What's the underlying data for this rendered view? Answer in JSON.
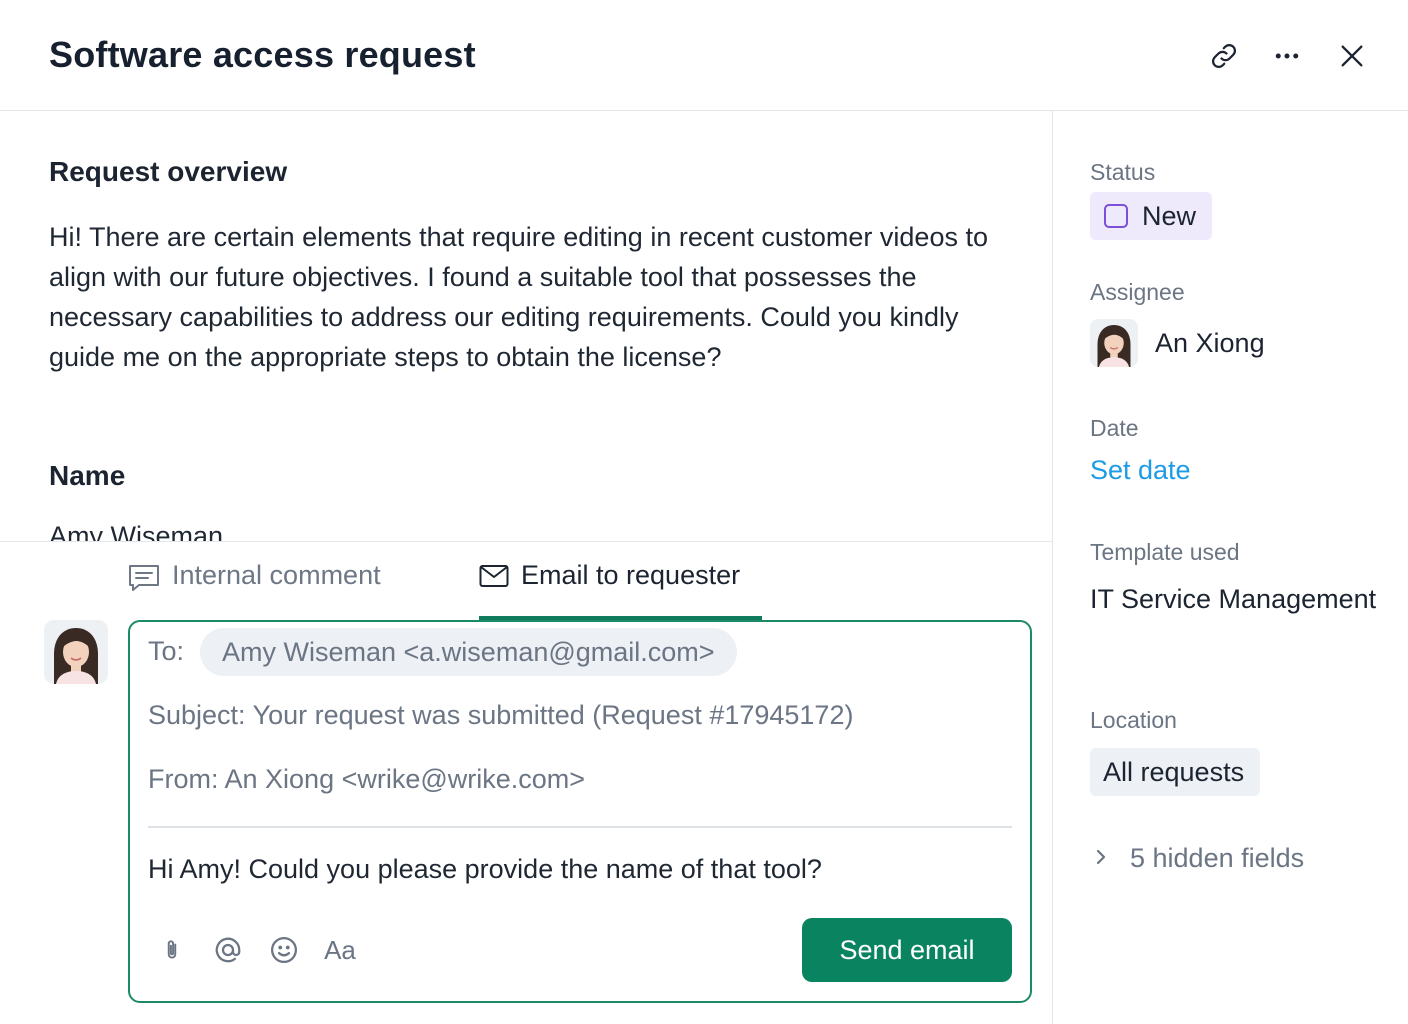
{
  "header": {
    "title": "Software access request",
    "icons": [
      "link-icon",
      "more-icon",
      "close-icon"
    ]
  },
  "main": {
    "overview_title": "Request overview",
    "overview_text": "Hi! There are certain elements that require editing in recent customer videos to align with our future objectives. I found a suitable tool that possesses the necessary capabilities to address our editing requirements. Could you kindly guide me on the appropriate steps to obtain the license?",
    "name_title": "Name",
    "name_value": "Amy Wiseman"
  },
  "composer": {
    "tabs": [
      {
        "label": "Internal comment",
        "icon": "comment-icon",
        "active": false
      },
      {
        "label": "Email to requester",
        "icon": "mail-icon",
        "active": true
      }
    ],
    "to_label": "To:",
    "to_value": "Amy Wiseman <a.wiseman@gmail.com>",
    "subject": "Subject: Your request was submitted (Request #17945172)",
    "from": "From: An Xiong <wrike@wrike.com>",
    "message": "Hi Amy! Could you please provide the name of that tool?",
    "toolbar": {
      "icons": [
        "attachment-icon",
        "mention-icon",
        "emoji-icon",
        "text-format-icon"
      ],
      "format_label": "Aa"
    },
    "send_label": "Send email",
    "accent_color": "#0a8460"
  },
  "sidebar": {
    "status_label": "Status",
    "status_value": "New",
    "status_color": "#7b4fd6",
    "assignee_label": "Assignee",
    "assignee_name": "An Xiong",
    "date_label": "Date",
    "date_value": "Set date",
    "template_label": "Template used",
    "template_value": "IT Service Management",
    "location_label": "Location",
    "location_value": "All requests",
    "hidden_fields": "5 hidden fields"
  }
}
